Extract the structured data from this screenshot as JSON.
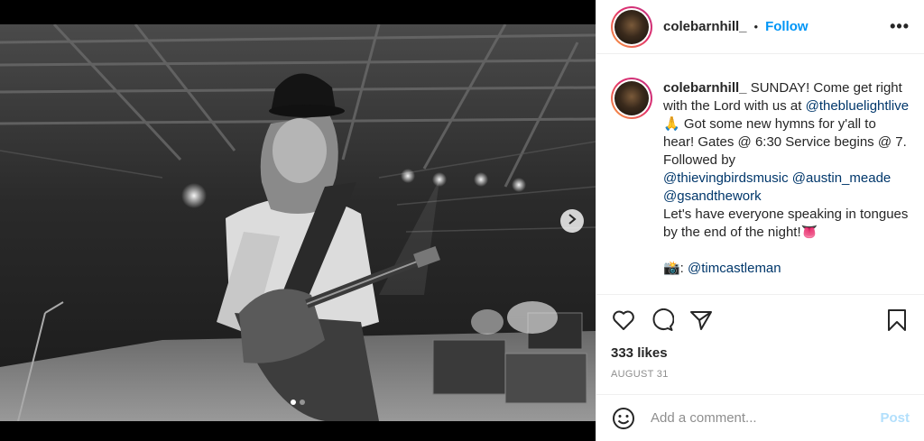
{
  "post": {
    "username": "colebarnhill_",
    "separator": "•",
    "follow_label": "Follow",
    "more_label": "•••",
    "image_description_icon": "photo",
    "carousel": {
      "count": 2,
      "active_index": 0
    }
  },
  "caption": {
    "username": "colebarnhill_",
    "line1": "SUNDAY! Come get right with the Lord with us at",
    "mention_venue": "@thebluelightlive",
    "venue_suffix": "🙏 Got some new hymns for y'all to hear! Gates @ 6:30 Service begins @ 7. Followed by",
    "mention_1": "@thievingbirdsmusic",
    "mention_2": "@austin_meade",
    "mention_3": "@gsandthework",
    "closing": "Let's have everyone speaking in tongues by the end of the night!👅",
    "photo_credit_emoji": "📸:",
    "photo_credit_mention": "@timcastleman"
  },
  "actions": {
    "like_icon": "heart-icon",
    "comment_icon": "comment-icon",
    "share_icon": "share-icon",
    "save_icon": "bookmark-icon"
  },
  "likes_text": "333 likes",
  "date_text": "AUGUST 31",
  "comment": {
    "placeholder": "Add a comment...",
    "post_label": "Post"
  },
  "colors": {
    "link": "#00376b",
    "follow": "#0095f6",
    "post_disabled": "#b2dffc",
    "muted": "#8e8e8e"
  }
}
